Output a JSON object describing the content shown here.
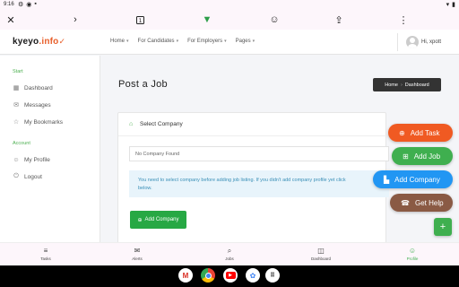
{
  "status_bar": {
    "time": "9:16"
  },
  "browser": {
    "icons": [
      "settings-icon",
      "location-icon",
      "chevron-left-icon",
      "tab-switcher-icon",
      "download-icon",
      "incognito-icon",
      "share-icon",
      "more-vertical-icon"
    ]
  },
  "site": {
    "logo_text": "kyeyo",
    "logo_suffix": ".info",
    "nav": [
      "Home",
      "For Candidates",
      "For Employers",
      "Pages"
    ],
    "user_label": "Hi, xpott"
  },
  "sidebar": {
    "sections": [
      {
        "title": "Start",
        "items": [
          {
            "label": "Dashboard",
            "icon": "dashboard-icon"
          },
          {
            "label": "Messages",
            "icon": "messages-icon"
          },
          {
            "label": "My Bookmarks",
            "icon": "star-icon"
          }
        ]
      },
      {
        "title": "Account",
        "items": [
          {
            "label": "My Profile",
            "icon": "user-icon"
          },
          {
            "label": "Logout",
            "icon": "power-icon"
          }
        ]
      }
    ]
  },
  "main": {
    "title": "Post a Job",
    "breadcrumb": [
      "Home",
      "Dashboard"
    ],
    "card_title": "Select Company",
    "select_value": "No Company Found",
    "notice": "You need to select company before adding job listing. If you didn't add company profile yet click",
    "notice_tail": "below.",
    "add_company_button": "Add Company"
  },
  "fabs": {
    "add_task": "Add Task",
    "add_job": "Add Job",
    "add_company": "Add Company",
    "get_help": "Get Help",
    "plus": "+"
  },
  "bottom_nav": [
    {
      "label": "Tasks",
      "icon": "tasks-icon"
    },
    {
      "label": "Alerts",
      "icon": "mail-icon"
    },
    {
      "label": "Jobs",
      "icon": "search-icon"
    },
    {
      "label": "Dashboard",
      "icon": "dashboard-icon"
    },
    {
      "label": "Profile",
      "icon": "user-icon"
    }
  ],
  "dock_apps": [
    "Gmail",
    "Chrome",
    "YouTube",
    "Photos",
    "App Drawer"
  ],
  "colors": {
    "brand_green": "#27a844",
    "fab_task": "#f05a22",
    "fab_job": "#3faf4f",
    "fab_company": "#2196f3",
    "fab_help": "#8a5a44",
    "breadcrumb_bg": "#333333",
    "notice_bg": "#e8f4fb"
  }
}
